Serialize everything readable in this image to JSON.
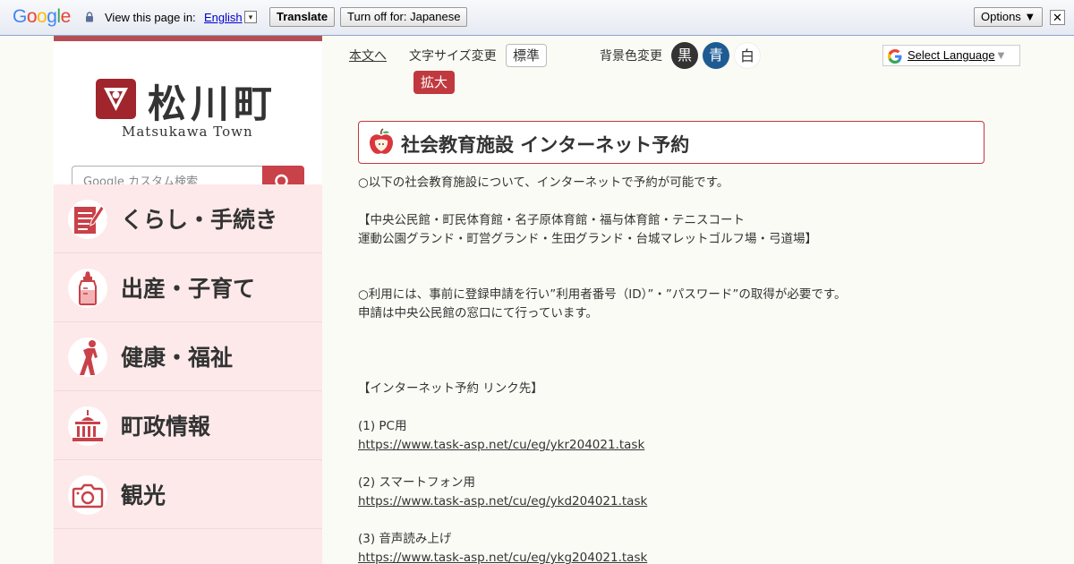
{
  "translate_bar": {
    "logo_letters": [
      "G",
      "o",
      "o",
      "g",
      "l",
      "e"
    ],
    "logo_colors": [
      "#4285f4",
      "#ea4335",
      "#fbbc05",
      "#4285f4",
      "#34a853",
      "#ea4335"
    ],
    "view_text": "View this page in:",
    "language": "English",
    "caret": "▾",
    "translate_button": "Translate",
    "turn_off_button": "Turn off for: Japanese",
    "options_button": "Options ▼",
    "close": "✕"
  },
  "sidebar": {
    "logo_name": "松川町",
    "logo_sub": "Matsukawa Town",
    "search_placeholder": "Google カスタム検索",
    "menu": [
      {
        "label": "くらし・手続き",
        "icon": "document-pen-icon"
      },
      {
        "label": "出産・子育て",
        "icon": "baby-bottle-icon"
      },
      {
        "label": "健康・福祉",
        "icon": "stretching-person-icon"
      },
      {
        "label": "町政情報",
        "icon": "government-building-icon"
      },
      {
        "label": "観光",
        "icon": "camera-icon"
      }
    ]
  },
  "toolbar": {
    "skip_link": "本文へ",
    "font_size_label": "文字サイズ変更",
    "size_normal": "標準",
    "size_large": "拡大",
    "bg_label": "背景色変更",
    "bg_black": "黒",
    "bg_blue": "青",
    "bg_white": "白",
    "select_language": "Select Language",
    "select_caret": "▼"
  },
  "content": {
    "title": "社会教育施設 インターネット予約",
    "intro": "○以下の社会教育施設について、インターネットで予約が可能です。",
    "facilities_line1": "【中央公民館・町民体育館・名子原体育館・福与体育館・テニスコート",
    "facilities_line2": "運動公園グランド・町営グランド・生田グランド・台城マレットゴルフ場・弓道場】",
    "usage_line1": "○利用には、事前に登録申請を行い”利用者番号（ID）”・”パスワード”の取得が必要です。",
    "usage_line2": "申請は中央公民館の窓口にて行っています。",
    "links_heading": "【インターネット予約 リンク先】",
    "links": [
      {
        "label": "(1) PC用",
        "url": "https://www.task-asp.net/cu/eg/ykr204021.task"
      },
      {
        "label": "(2) スマートフォン用",
        "url": "https://www.task-asp.net/cu/eg/ykd204021.task"
      },
      {
        "label": "(3) 音声読み上げ",
        "url": "https://www.task-asp.net/cu/eg/ykg204021.task"
      }
    ]
  },
  "colors": {
    "accent_red": "#c0393f",
    "menu_bg": "#fde9e9",
    "blue_bg_button": "#1f5b93"
  }
}
